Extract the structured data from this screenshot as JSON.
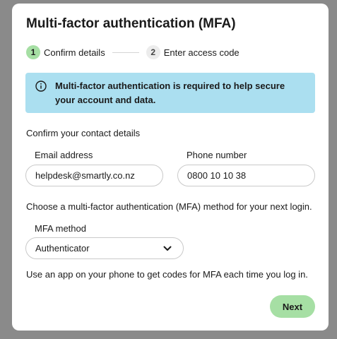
{
  "modal": {
    "title": "Multi-factor authentication (MFA)"
  },
  "stepper": {
    "steps": [
      {
        "number": "1",
        "label": "Confirm details",
        "state": "active"
      },
      {
        "number": "2",
        "label": "Enter access code",
        "state": "inactive"
      }
    ]
  },
  "info": {
    "icon": "info-icon",
    "text": "Multi-factor authentication is required to help secure your account and data."
  },
  "contact": {
    "heading": "Confirm your contact details",
    "email_label": "Email address",
    "email_value": "helpdesk@smartly.co.nz",
    "phone_label": "Phone number",
    "phone_value": "0800 10 10 38"
  },
  "mfa": {
    "prompt": "Choose a multi-factor authentication (MFA) method for your next login.",
    "method_label": "MFA method",
    "method_value": "Authenticator",
    "method_hint": "Use an app on your phone to get codes for MFA each time you log in."
  },
  "actions": {
    "next_label": "Next"
  },
  "colors": {
    "accent_green": "#a6dfa4",
    "info_background": "#abdff0",
    "backdrop": "#8a8a8a"
  }
}
